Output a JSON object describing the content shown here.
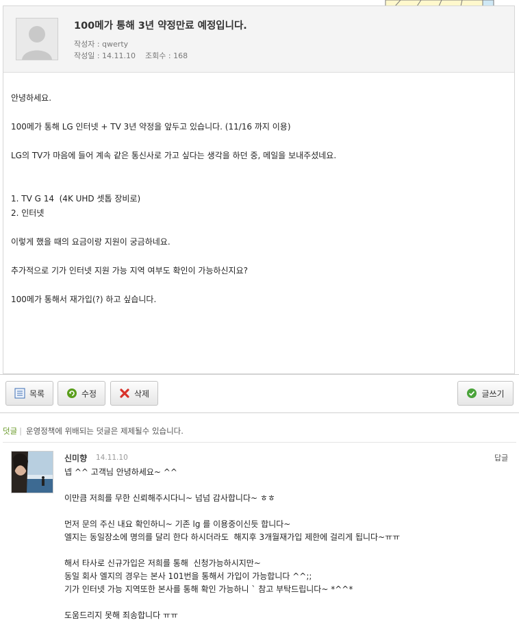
{
  "post": {
    "title": "100메가 통해 3년 약정만료 예정입니다.",
    "author_line": "작성자 : qwerty",
    "date_line": "작성일 : 14.11.10",
    "views_line": "조회수 : 168",
    "body": [
      "안녕하세요.",
      "",
      "100메가 통해 LG 인터넷 + TV 3년 약정을 앞두고 있습니다. (11/16 까지 이용)",
      "",
      "LG의 TV가 마음에 들어 계속 같은 통신사로 가고 싶다는 생각을 하던 중, 메일을 보내주셨네요.",
      "",
      "",
      "1. TV G 14  (4K UHD 셋톱 장비로)",
      "2. 인터넷",
      "",
      "이렇게 했을 때의 요금이랑 지원이 궁금하네요.",
      "",
      "추가적으로 기가 인터넷 지원 가능 지역 여부도 확인이 가능하신지요?",
      "",
      "100메가 통해서 재가입(?) 하고 싶습니다."
    ]
  },
  "buttons": {
    "list": "목록",
    "edit": "수정",
    "delete": "삭제",
    "write": "글쓰기"
  },
  "comments_bar": {
    "label": "덧글",
    "separator": "|",
    "notice": "운영정책에 위배되는 덧글은 제제될수 있습니다."
  },
  "comment": {
    "author": "신미향",
    "date": "14.11.10",
    "reply": "답글",
    "body": [
      "넵 ^^ 고객님 안녕하세요~ ^^",
      "",
      "이만큼 저희를 무한 신뢰해주시다니~ 넘넘 감사합니다~ ㅎㅎ",
      "",
      "먼저 문의 주신 내요 확인하니~ 기존 lg 를 이용중이신듯 합니다~",
      "엘지는 동일장소에 명의를 달리 한다 하시더라도  해지후 3개월재가입 제한에 걸리게 됩니다~ㅠㅠ",
      "",
      "해서 타사로 신규가입은 저희를 통해  신청가능하시지만~",
      "동일 회사 엘지의 경우는 본사 101번을 통해서 가입이 가능합니다 ^^;;",
      "기가 인터넷 가능 지역또한 본사를 통해 확인 가능하니 ` 참고 부탁드립니다~ *^^*",
      "",
      "도움드리지 못해 죄송합니다 ㅠㅠ"
    ]
  },
  "colors": {
    "comment_label": "#6a9a2a",
    "delete_icon": "#d8322a",
    "edit_icon": "#5a9e1c",
    "write_icon": "#4aa33a",
    "list_icon": "#3d6fb5"
  }
}
